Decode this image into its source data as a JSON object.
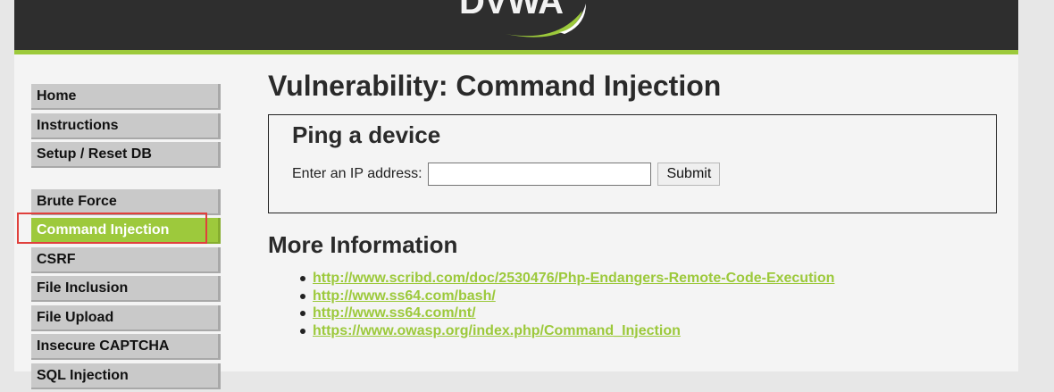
{
  "header": {
    "logo_text": "DVWA"
  },
  "menu": {
    "group1": [
      "Home",
      "Instructions",
      "Setup / Reset DB"
    ],
    "group2": [
      "Brute Force",
      "Command Injection",
      "CSRF",
      "File Inclusion",
      "File Upload",
      "Insecure CAPTCHA",
      "SQL Injection"
    ],
    "selected": "Command Injection"
  },
  "main": {
    "title": "Vulnerability: Command Injection",
    "box_title": "Ping a device",
    "ip_label": "Enter an IP address:",
    "ip_value": "",
    "submit_label": "Submit",
    "more_info_title": "More Information",
    "links": [
      "http://www.scribd.com/doc/2530476/Php-Endangers-Remote-Code-Execution",
      "http://www.ss64.com/bash/",
      "http://www.ss64.com/nt/",
      "https://www.owasp.org/index.php/Command_Injection"
    ]
  },
  "colors": {
    "accent": "#9cc93b",
    "header_bg": "#2e2e2e",
    "highlight": "#e0403c"
  }
}
